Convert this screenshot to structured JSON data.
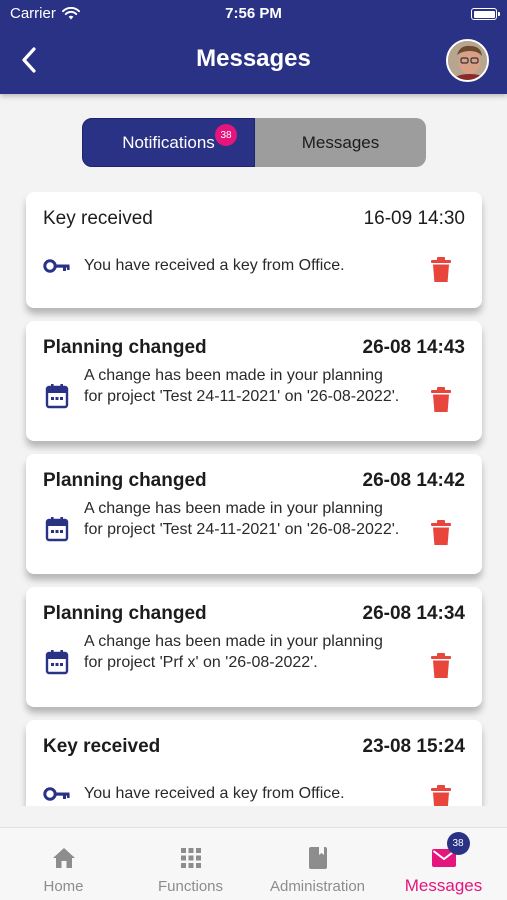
{
  "status_bar": {
    "carrier": "Carrier",
    "time": "7:56 PM"
  },
  "header": {
    "title": "Messages"
  },
  "segmented": {
    "notifications_label": "Notifications",
    "notifications_badge": "38",
    "messages_label": "Messages",
    "selected": "Notifications"
  },
  "cards": [
    {
      "title": "Key received",
      "date": "16-09 14:30",
      "text": "You have received a key from Office.",
      "icon": "key-icon",
      "bold": false
    },
    {
      "title": "Planning changed",
      "date": "26-08 14:43",
      "text": "A change has been made in your planning for project 'Test 24-11-2021' on '26-08-2022'.",
      "icon": "calendar-icon",
      "bold": true
    },
    {
      "title": "Planning changed",
      "date": "26-08 14:42",
      "text": "A change has been made in your planning for project 'Test 24-11-2021' on '26-08-2022'.",
      "icon": "calendar-icon",
      "bold": true
    },
    {
      "title": "Planning changed",
      "date": "26-08 14:34",
      "text": "A change has been made in your planning for project 'Prf x' on '26-08-2022'.",
      "icon": "calendar-icon",
      "bold": true
    },
    {
      "title": "Key received",
      "date": "23-08 15:24",
      "text": "You have received a key from Office.",
      "icon": "key-icon",
      "bold": true
    }
  ],
  "tabbar": {
    "home": "Home",
    "functions": "Functions",
    "administration": "Administration",
    "messages": "Messages",
    "messages_badge": "38"
  },
  "colors": {
    "primary": "#2a3285",
    "accent": "#e5157d",
    "delete": "#e8453c"
  }
}
